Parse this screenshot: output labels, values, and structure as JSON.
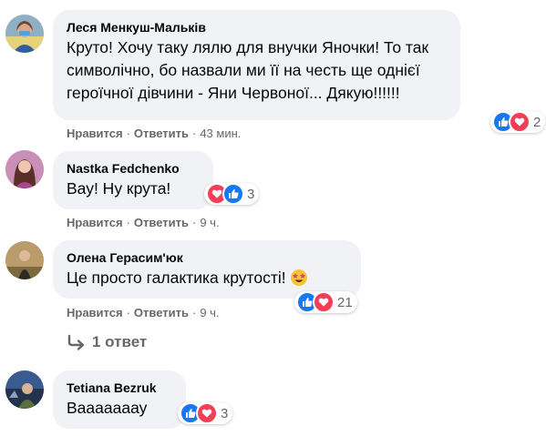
{
  "comments": [
    {
      "author": "Леся Менкуш-Мальків",
      "text": "Круто! Хочу таку лялю для внучки Яночки! То так\nсимволічно, бо назвали ми її на честь ще однієї\nгероїчної дівчини - Яни Червоної... Дякую!!!!!!",
      "like_label": "Нравится",
      "reply_label": "Ответить",
      "time": "43 мин.",
      "reaction_icons": [
        "like-icon",
        "love-icon"
      ],
      "reaction_count": "2"
    },
    {
      "author": "Nastka Fedchenko",
      "text": "Вау! Ну крута!",
      "like_label": "Нравится",
      "reply_label": "Ответить",
      "time": "9 ч.",
      "reaction_icons": [
        "love-icon",
        "like-icon"
      ],
      "reaction_count": "3"
    },
    {
      "author": "Олена Герасим'юк",
      "text": "Це просто галактика крутості!",
      "emoji": "star-struck-emoji",
      "like_label": "Нравится",
      "reply_label": "Ответить",
      "time": "9 ч.",
      "reaction_icons": [
        "like-icon",
        "love-icon"
      ],
      "reaction_count": "21"
    },
    {
      "author": "Tetiana Bezruk",
      "text": "Вааааааау",
      "reaction_icons": [
        "like-icon",
        "love-icon"
      ],
      "reaction_count": "3"
    }
  ],
  "replies_link": "1 ответ",
  "colors": {
    "like": "#1877f2",
    "love": "#f33e58",
    "bubble": "#f0f2f5",
    "meta": "#65676b"
  }
}
